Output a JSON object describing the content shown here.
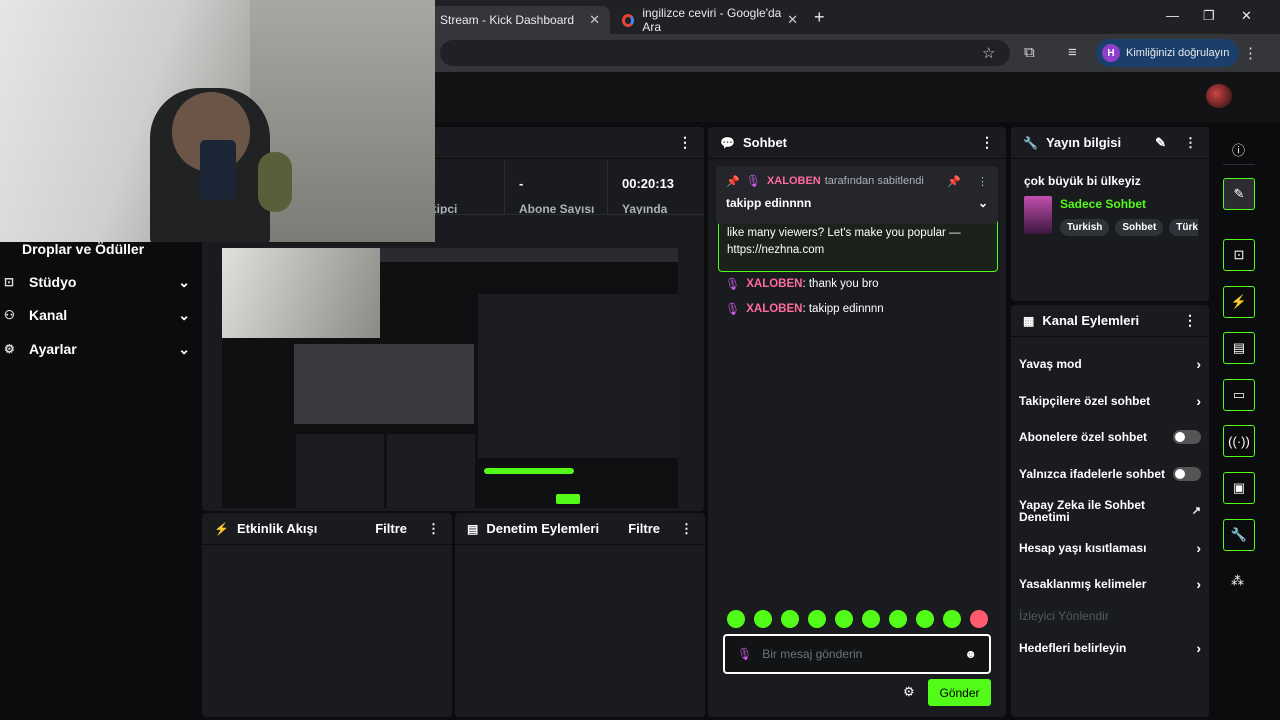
{
  "browser": {
    "tabs": [
      {
        "label": "Stream - Kick Dashboard",
        "active": true
      },
      {
        "label": "ingilizce ceviri - Google'da Ara",
        "active": false
      }
    ],
    "profile_label": "Kimliğinizi doğrulayın",
    "profile_initial": "H"
  },
  "sidebar": {
    "items": [
      {
        "label": "Droplar ve Ödüller"
      },
      {
        "label": "Stüdyo"
      },
      {
        "label": "Kanal"
      },
      {
        "label": "Ayarlar"
      }
    ]
  },
  "stats": {
    "partial_label": "kipci",
    "subs_value": "-",
    "subs_label": "Abone Sayısı",
    "uptime_value": "00:20:13",
    "uptime_label": "Yayında"
  },
  "activity": {
    "title": "Etkinlik Akışı",
    "filter": "Filtre"
  },
  "moderation": {
    "title": "Denetim Eylemleri",
    "filter": "Filtre"
  },
  "chat": {
    "title": "Sohbet",
    "pinned_user": "XALOBEN",
    "pinned_by_text": "tarafından sabitlendi",
    "pinned_message": "takipp edinnnn",
    "highlight_text_1": "like many viewers? Let's make you popular —",
    "highlight_text_2": "https://nezhna.com",
    "messages": [
      {
        "user": "XALOBEN",
        "text": "thank you bro"
      },
      {
        "user": "XALOBEN",
        "text": "takipp edinnnn"
      }
    ],
    "input_placeholder": "Bir mesaj gönderin",
    "send_label": "Gönder"
  },
  "stream_info": {
    "title": "Yayın bilgisi",
    "stream_title": "çok büyük bi ülkeyiz",
    "category": "Sadece Sohbet",
    "tags": [
      "Turkish",
      "Sohbet",
      "Türk"
    ]
  },
  "channel_actions": {
    "title": "Kanal Eylemleri",
    "items": [
      {
        "label": "Yavaş mod",
        "control": "arrow"
      },
      {
        "label": "Takipçilere özel sohbet",
        "control": "arrow"
      },
      {
        "label": "Abonelere özel sohbet",
        "control": "toggle"
      },
      {
        "label": "Yalnızca ifadelerle sohbet",
        "control": "toggle"
      },
      {
        "label": "Yapay Zeka ile Sohbet Denetimi",
        "control": "external"
      },
      {
        "label": "Hesap yaşı kısıtlaması",
        "control": "arrow"
      },
      {
        "label": "Yasaklanmış kelimeler",
        "control": "arrow"
      },
      {
        "label": "İzleyici Yönlendir",
        "control": "none"
      },
      {
        "label": "Hedefleri belirleyin",
        "control": "arrow"
      }
    ]
  },
  "colors": {
    "accent": "#53fc18",
    "username": "#ff6b9d",
    "mic": "#cc5de8"
  }
}
